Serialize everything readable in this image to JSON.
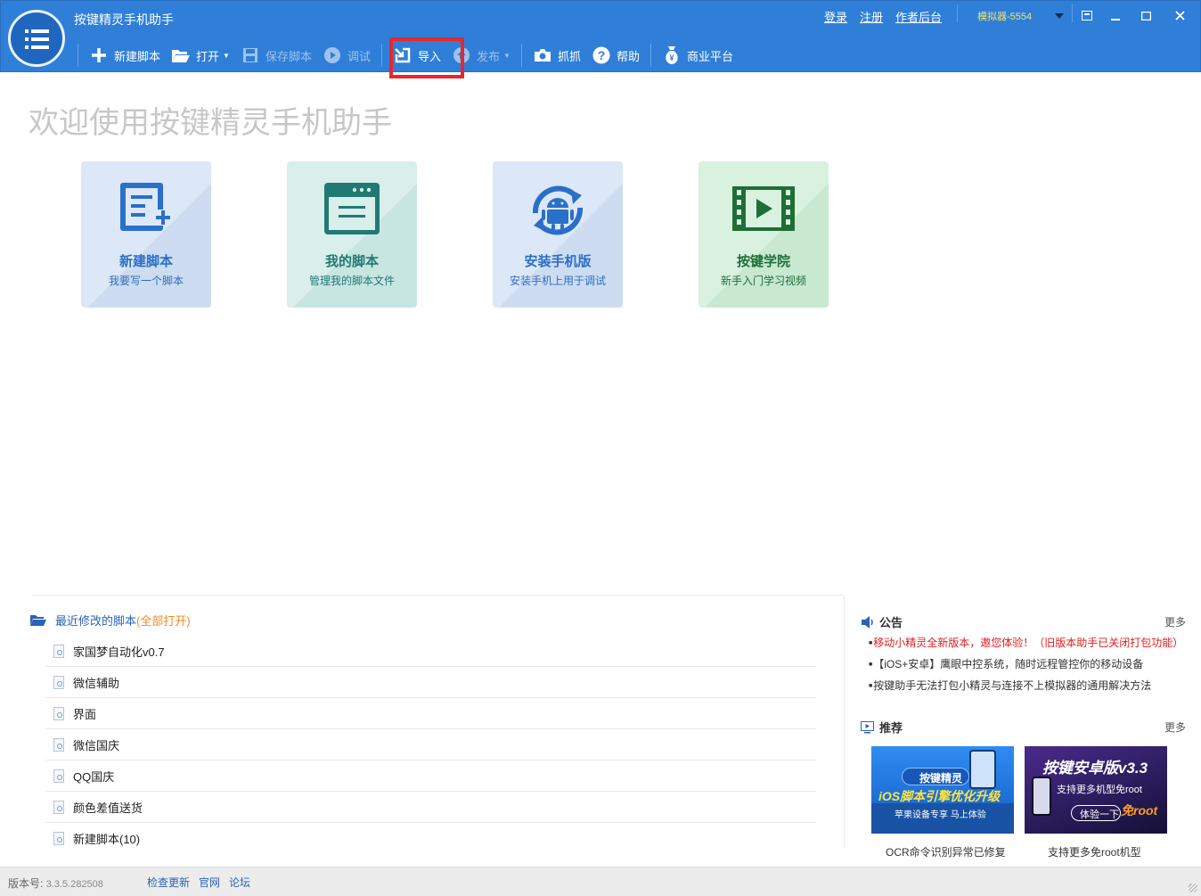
{
  "app": {
    "title": "按键精灵手机助手"
  },
  "top_links": {
    "login": "登录",
    "register": "注册",
    "author_backend": "作者后台"
  },
  "emulator": {
    "label": "模拟器-5554"
  },
  "toolbar": {
    "new_script": "新建脚本",
    "open": "打开",
    "save_script": "保存脚本",
    "debug": "调试",
    "import": "导入",
    "publish": "发布",
    "capture": "抓抓",
    "help": "帮助",
    "business": "商业平台"
  },
  "welcome": {
    "heading": "欢迎使用按键精灵手机助手"
  },
  "cards": [
    {
      "title": "新建脚本",
      "subtitle": "我要写一个脚本",
      "color": "#2a6fc8"
    },
    {
      "title": "我的脚本",
      "subtitle": "管理我的脚本文件",
      "color": "#217a72"
    },
    {
      "title": "安装手机版",
      "subtitle": "安装手机上用于调试",
      "color": "#2a6fc8"
    },
    {
      "title": "按键学院",
      "subtitle": "新手入门学习视频",
      "color": "#1d6e38"
    }
  ],
  "recent": {
    "heading": "最近修改的脚本",
    "open_all": "(全部打开)",
    "items": [
      "家国梦自动化v0.7",
      "微信辅助",
      "界面",
      "微信国庆",
      "QQ国庆",
      "颜色差值送货",
      "新建脚本(10)"
    ]
  },
  "announcements": {
    "heading": "公告",
    "more": "更多",
    "items": [
      "移动小精灵全新版本，邀您体验！（旧版本助手已关闭打包功能）",
      "【iOS+安卓】鹰眼中控系统，随时远程管控你的移动设备",
      "按键助手无法打包小精灵与连接不上模拟器的通用解决方法"
    ]
  },
  "recommend": {
    "heading": "推荐",
    "more": "更多",
    "banners": [
      {
        "brand": "按键精灵",
        "headline": "iOS脚本引擎优化升级",
        "tagline": "苹果设备专享 马上体验",
        "caption": "OCR命令识别异常已修复"
      },
      {
        "brand": "按键安卓版v3.3",
        "headline": "支持更多机型免root",
        "tagline": "体验一下",
        "badge": "免root",
        "caption": "支持更多免root机型"
      }
    ]
  },
  "status": {
    "version_label": "版本号:",
    "version": "3.3.5.282508",
    "links": [
      "检查更新",
      "官网",
      "论坛"
    ]
  }
}
